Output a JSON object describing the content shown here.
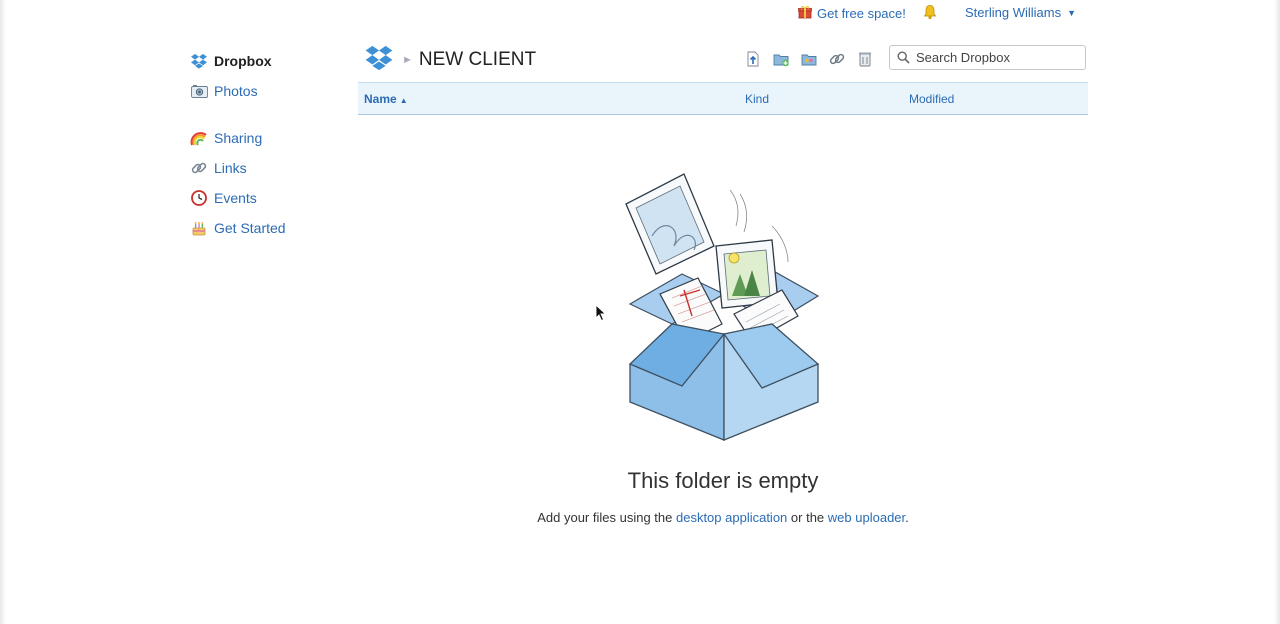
{
  "topbar": {
    "gift_label": "Get free space!",
    "user_name": "Sterling Williams"
  },
  "sidebar": {
    "items": [
      {
        "label": "Dropbox",
        "icon": "dropbox-icon"
      },
      {
        "label": "Photos",
        "icon": "camera-icon"
      },
      {
        "label": "Sharing",
        "icon": "rainbow-icon"
      },
      {
        "label": "Links",
        "icon": "chain-link-icon"
      },
      {
        "label": "Events",
        "icon": "clock-icon"
      },
      {
        "label": "Get Started",
        "icon": "cake-icon"
      }
    ]
  },
  "header": {
    "folder_title": "NEW CLIENT",
    "search_placeholder": "Search Dropbox",
    "tools": [
      "upload-file-icon",
      "new-folder-icon",
      "shared-folder-icon",
      "share-link-icon",
      "deleted-files-icon"
    ]
  },
  "columns": {
    "name": "Name",
    "kind": "Kind",
    "modified": "Modified"
  },
  "empty": {
    "title": "This folder is empty",
    "text_before": "Add your files using the",
    "link1": "desktop application",
    "text_middle": "or the",
    "link2": "web uploader",
    "text_after": "."
  },
  "colors": {
    "link": "#2b6cb5",
    "brand": "#3d8fd6",
    "column_header_bg": "#eaf4fb"
  }
}
